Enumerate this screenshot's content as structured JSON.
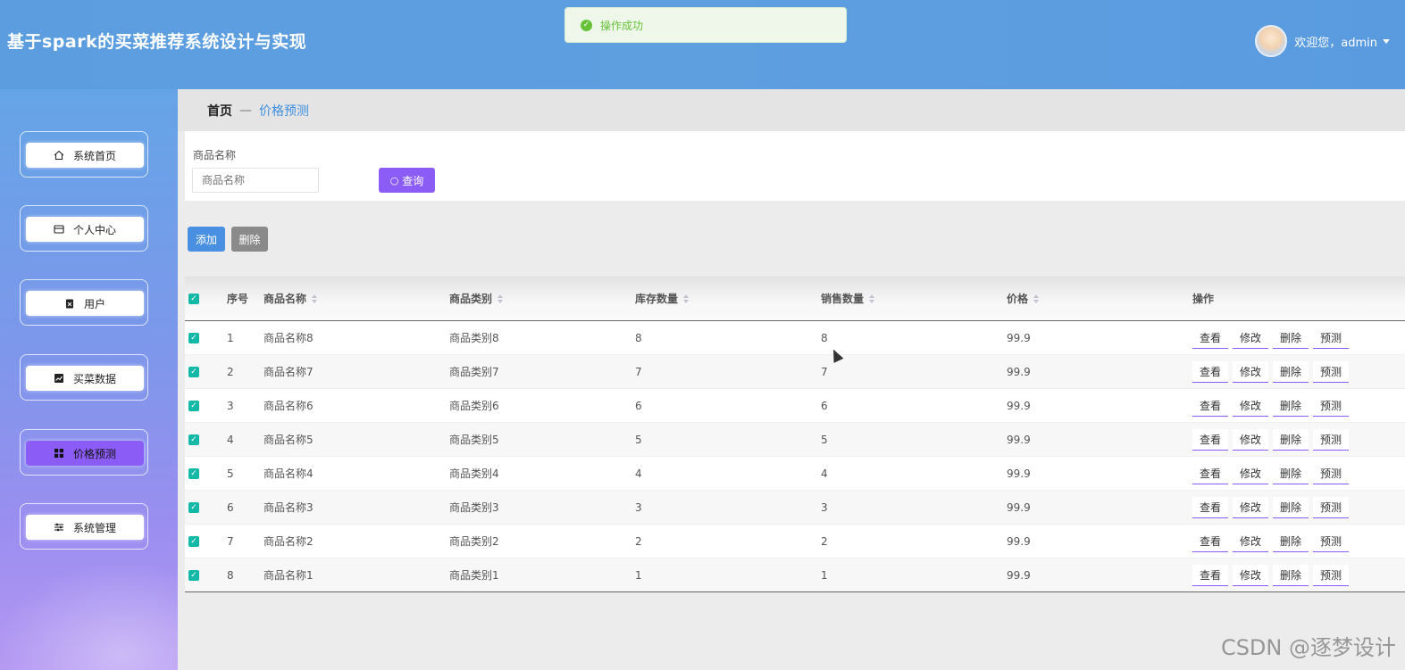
{
  "app": {
    "title": "基于spark的买菜推荐系统设计与实现"
  },
  "toast": {
    "message": "操作成功",
    "icon": "check-circle-icon",
    "color": "#67c23a"
  },
  "user": {
    "greeting": "欢迎您，admin"
  },
  "sidebar": {
    "items": [
      {
        "label": "系统首页",
        "icon": "home-icon",
        "active": false
      },
      {
        "label": "个人中心",
        "icon": "card-icon",
        "active": false
      },
      {
        "label": "用户",
        "icon": "clipboard-icon",
        "active": false
      },
      {
        "label": "买菜数据",
        "icon": "chart-icon",
        "active": false
      },
      {
        "label": "价格预测",
        "icon": "grid-icon",
        "active": true
      },
      {
        "label": "系统管理",
        "icon": "sliders-icon",
        "active": false
      }
    ]
  },
  "breadcrumb": {
    "home": "首页",
    "separator": "—",
    "current": "价格预测"
  },
  "search": {
    "label": "商品名称",
    "placeholder": "商品名称",
    "button": "查询"
  },
  "actions": {
    "add": "添加",
    "delete": "删除"
  },
  "table": {
    "headers": [
      "序号",
      "商品名称",
      "商品类别",
      "库存数量",
      "销售数量",
      "价格",
      "操作"
    ],
    "rows": [
      {
        "index": "1",
        "name": "商品名称8",
        "category": "商品类别8",
        "stock": "8",
        "sales": "8",
        "price": "99.9"
      },
      {
        "index": "2",
        "name": "商品名称7",
        "category": "商品类别7",
        "stock": "7",
        "sales": "7",
        "price": "99.9"
      },
      {
        "index": "3",
        "name": "商品名称6",
        "category": "商品类别6",
        "stock": "6",
        "sales": "6",
        "price": "99.9"
      },
      {
        "index": "4",
        "name": "商品名称5",
        "category": "商品类别5",
        "stock": "5",
        "sales": "5",
        "price": "99.9"
      },
      {
        "index": "5",
        "name": "商品名称4",
        "category": "商品类别4",
        "stock": "4",
        "sales": "4",
        "price": "99.9"
      },
      {
        "index": "6",
        "name": "商品名称3",
        "category": "商品类别3",
        "stock": "3",
        "sales": "3",
        "price": "99.9"
      },
      {
        "index": "7",
        "name": "商品名称2",
        "category": "商品类别2",
        "stock": "2",
        "sales": "2",
        "price": "99.9"
      },
      {
        "index": "8",
        "name": "商品名称1",
        "category": "商品类别1",
        "stock": "1",
        "sales": "1",
        "price": "99.9"
      }
    ],
    "row_actions": [
      "查看",
      "修改",
      "删除",
      "预测"
    ]
  },
  "watermark": "CSDN @逐梦设计",
  "colors": {
    "header": "#5b9ddf",
    "accent": "#8b5cf6",
    "add_button": "#4a90e2",
    "checkbox": "#14b8a6"
  }
}
